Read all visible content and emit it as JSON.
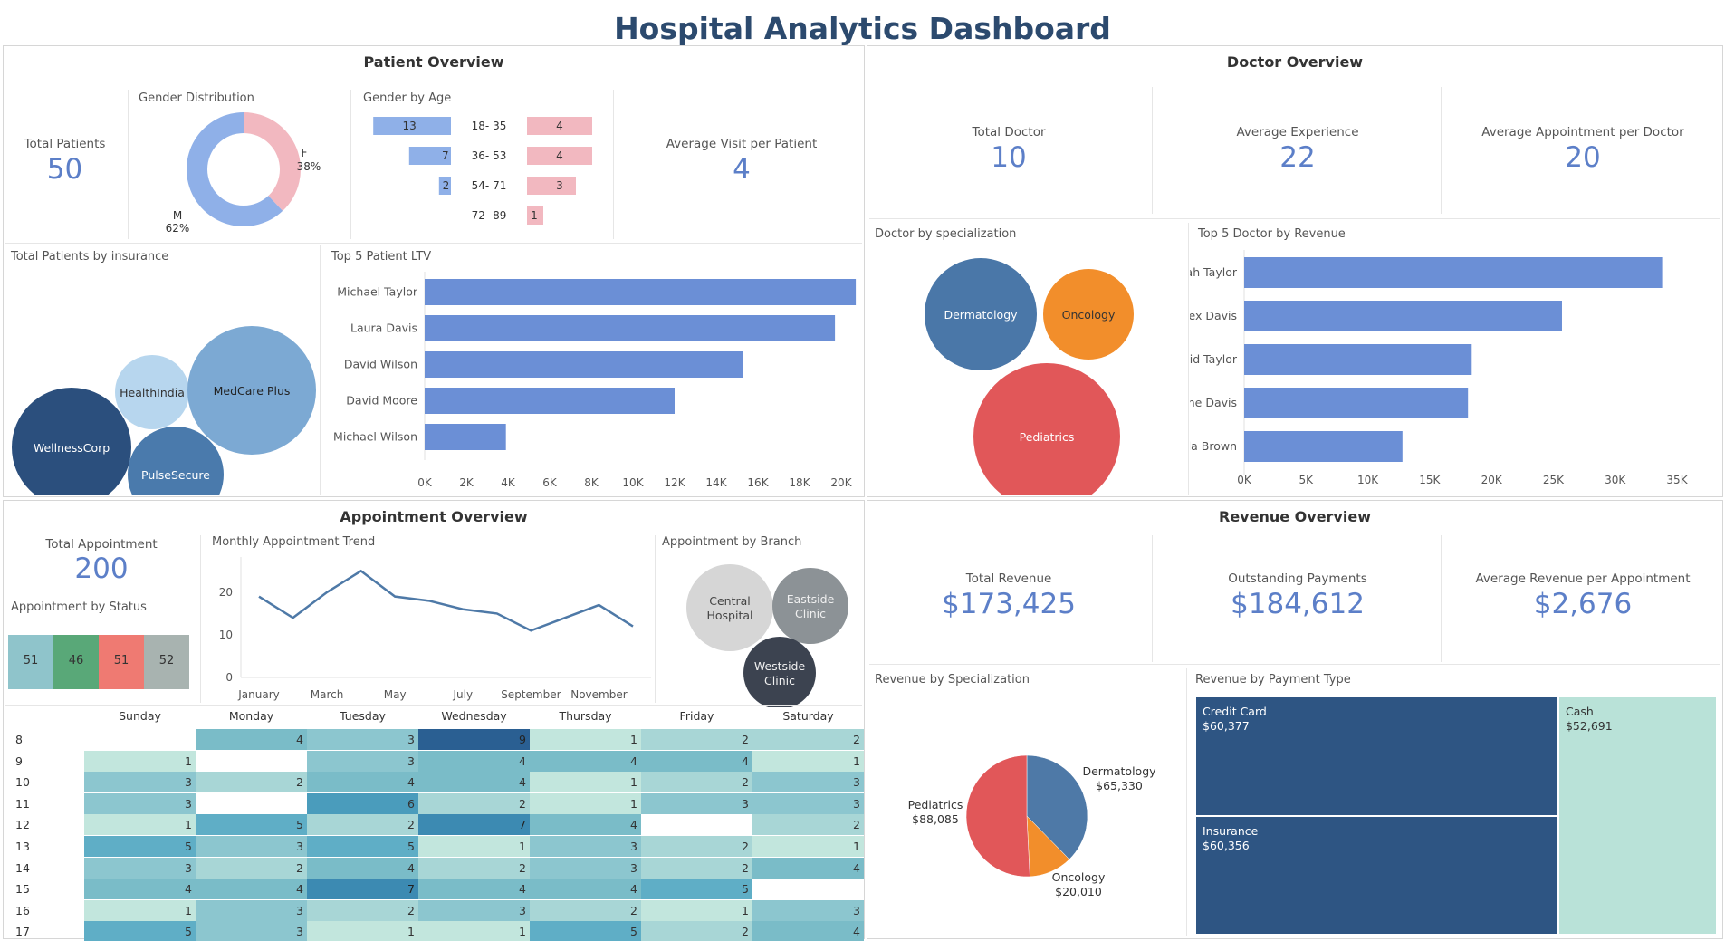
{
  "title": "Hospital Analytics Dashboard",
  "colors": {
    "title": "#2c4a6e",
    "kpi": "#5c7fc8",
    "bar_blue": "#6b8fd6",
    "female_pink": "#f2b8c0",
    "male_blue": "#8fb0e8"
  },
  "patient_overview": {
    "title": "Patient Overview",
    "total_patients_label": "Total Patients",
    "total_patients_value": "50",
    "avg_visit_label": "Average Visit per Patient",
    "avg_visit_value": "4",
    "gender_distribution_title": "Gender Distribution",
    "gender_by_age_title": "Gender by Age",
    "insurance_title": "Total Patients by insurance",
    "ltv_title": "Top 5 Patient LTV"
  },
  "doctor_overview": {
    "title": "Doctor Overview",
    "total_doctor_label": "Total Doctor",
    "total_doctor_value": "10",
    "avg_exp_label": "Average Experience",
    "avg_exp_value": "22",
    "avg_appt_label": "Average Appointment per Doctor",
    "avg_appt_value": "20",
    "specialization_title": "Doctor by specialization",
    "revenue_title": "Top 5 Doctor by Revenue"
  },
  "appointment_overview": {
    "title": "Appointment Overview",
    "total_label": "Total Appointment",
    "total_value": "200",
    "status_title": "Appointment by Status",
    "trend_title": "Monthly Appointment Trend",
    "branch_title": "Appointment by Branch"
  },
  "revenue_overview": {
    "title": "Revenue Overview",
    "total_label": "Total Revenue",
    "total_value": "$173,425",
    "outstanding_label": "Outstanding Payments",
    "outstanding_value": "$184,612",
    "avg_label": "Average Revenue per Appointment",
    "avg_value": "$2,676",
    "spec_title": "Revenue by Specialization",
    "payment_title": "Revenue by Payment Type"
  },
  "chart_data": [
    {
      "id": "gender_distribution",
      "type": "pie",
      "slices": [
        {
          "label": "F",
          "pct_label": "38%",
          "value": 38,
          "color": "#f2b8c0"
        },
        {
          "label": "M",
          "pct_label": "62%",
          "value": 62,
          "color": "#8fb0e8"
        }
      ]
    },
    {
      "id": "gender_by_age",
      "type": "bar",
      "categories": [
        "18- 35",
        "36- 53",
        "54- 71",
        "72- 89"
      ],
      "series": [
        {
          "values": [
            13,
            7,
            2,
            0
          ],
          "color": "#8fb0e8"
        },
        {
          "values": [
            4,
            4,
            3,
            1
          ],
          "color": "#f2b8c0"
        }
      ]
    },
    {
      "id": "patients_by_insurance",
      "type": "bubble",
      "items": [
        {
          "label": "WellnessCorp",
          "value": 14,
          "color": "#2b4f7d"
        },
        {
          "label": "HealthIndia",
          "value": 6,
          "color": "#b7d6ee"
        },
        {
          "label": "MedCare Plus",
          "value": 17,
          "color": "#7ca9d3"
        },
        {
          "label": "PulseSecure",
          "value": 9,
          "color": "#4a7aac"
        }
      ]
    },
    {
      "id": "top5_patient_ltv",
      "type": "bar",
      "orientation": "horizontal",
      "categories": [
        "Michael Taylor",
        "Laura Davis",
        "David Wilson",
        "David Moore",
        "Michael Wilson"
      ],
      "values": [
        20700,
        19700,
        15300,
        12000,
        3900
      ],
      "ticks": [
        "0K",
        "2K",
        "4K",
        "6K",
        "8K",
        "10K",
        "12K",
        "14K",
        "16K",
        "18K",
        "20K"
      ],
      "xlim": [
        0,
        21000
      ]
    },
    {
      "id": "doctor_by_specialization",
      "type": "bubble",
      "items": [
        {
          "label": "Dermatology",
          "value": 4,
          "color": "#4a77a8"
        },
        {
          "label": "Oncology",
          "value": 2,
          "color": "#f28e2b"
        },
        {
          "label": "Pediatrics",
          "value": 5,
          "color": "#e15759"
        }
      ]
    },
    {
      "id": "top5_doctor_revenue",
      "type": "bar",
      "orientation": "horizontal",
      "categories": [
        "Sarah Taylor",
        "Alex Davis",
        "David Taylor",
        "Jane Davis",
        "Linda Brown"
      ],
      "values": [
        33800,
        25700,
        18400,
        18100,
        12800
      ],
      "ticks": [
        "0K",
        "5K",
        "10K",
        "15K",
        "20K",
        "25K",
        "30K",
        "35K"
      ],
      "xlim": [
        0,
        35000
      ]
    },
    {
      "id": "appointment_by_status",
      "type": "bar",
      "values": [
        51,
        46,
        51,
        52
      ],
      "colors": [
        "#8fc4cb",
        "#59a878",
        "#ef7a72",
        "#a8b3b0"
      ]
    },
    {
      "id": "monthly_appointment_trend",
      "type": "line",
      "x": [
        "January",
        "February",
        "March",
        "April",
        "May",
        "June",
        "July",
        "August",
        "September",
        "October",
        "November",
        "December"
      ],
      "x_tick_labels": [
        "January",
        "March",
        "May",
        "July",
        "September",
        "November"
      ],
      "y": [
        19,
        14,
        20,
        25,
        19,
        18,
        16,
        15,
        11,
        14,
        17,
        12
      ],
      "ylim": [
        0,
        27
      ],
      "y_ticks": [
        "0",
        "10",
        "20"
      ]
    },
    {
      "id": "appointment_by_branch",
      "type": "bubble",
      "items": [
        {
          "label": "Central Hospital",
          "lines": [
            "Central",
            "Hospital"
          ],
          "value": 70,
          "color": "#d6d6d6",
          "text_color": "#444"
        },
        {
          "label": "Eastside Clinic",
          "lines": [
            "Eastside",
            "Clinic"
          ],
          "value": 65,
          "color": "#8c9296",
          "text_color": "#f0f0f0"
        },
        {
          "label": "Westside Clinic",
          "lines": [
            "Westside",
            "Clinic"
          ],
          "value": 65,
          "color": "#3c4350",
          "text_color": "#f0f0f0"
        }
      ]
    },
    {
      "id": "appointment_heatmap",
      "type": "heatmap",
      "columns": [
        "Sunday",
        "Monday",
        "Tuesday",
        "Wednesday",
        "Thursday",
        "Friday",
        "Saturday"
      ],
      "rows": [
        "8",
        "9",
        "10",
        "11",
        "12",
        "13",
        "14",
        "15",
        "16",
        "17"
      ],
      "values": [
        [
          "",
          "4",
          "3",
          "9",
          "1",
          "2",
          "2"
        ],
        [
          "1",
          "",
          "3",
          "4",
          "4",
          "4",
          "1"
        ],
        [
          "3",
          "2",
          "4",
          "4",
          "1",
          "2",
          "3"
        ],
        [
          "3",
          "",
          "6",
          "2",
          "1",
          "3",
          "3"
        ],
        [
          "1",
          "5",
          "2",
          "7",
          "4",
          "",
          "2"
        ],
        [
          "5",
          "3",
          "5",
          "1",
          "3",
          "2",
          "1"
        ],
        [
          "3",
          "2",
          "4",
          "2",
          "3",
          "2",
          "4"
        ],
        [
          "4",
          "4",
          "7",
          "4",
          "4",
          "5",
          ""
        ],
        [
          "1",
          "3",
          "2",
          "3",
          "2",
          "1",
          "3"
        ],
        [
          "5",
          "3",
          "1",
          "1",
          "5",
          "2",
          "4"
        ]
      ]
    },
    {
      "id": "revenue_by_specialization",
      "type": "pie",
      "slices": [
        {
          "label": "Dermatology",
          "value_label": "$65,330",
          "value": 65330,
          "color": "#4e79a7"
        },
        {
          "label": "Oncology",
          "value_label": "$20,010",
          "value": 20010,
          "color": "#f28e2b"
        },
        {
          "label": "Pediatrics",
          "value_label": "$88,085",
          "value": 88085,
          "color": "#e15759"
        }
      ]
    },
    {
      "id": "revenue_by_payment_type",
      "type": "treemap",
      "items": [
        {
          "label": "Credit Card",
          "value_label": "$60,377",
          "value": 60377,
          "color": "#2e5583"
        },
        {
          "label": "Insurance",
          "value_label": "$60,356",
          "value": 60356,
          "color": "#2e5583"
        },
        {
          "label": "Cash",
          "value_label": "$52,691",
          "value": 52691,
          "color": "#b9e2d8"
        }
      ]
    }
  ]
}
